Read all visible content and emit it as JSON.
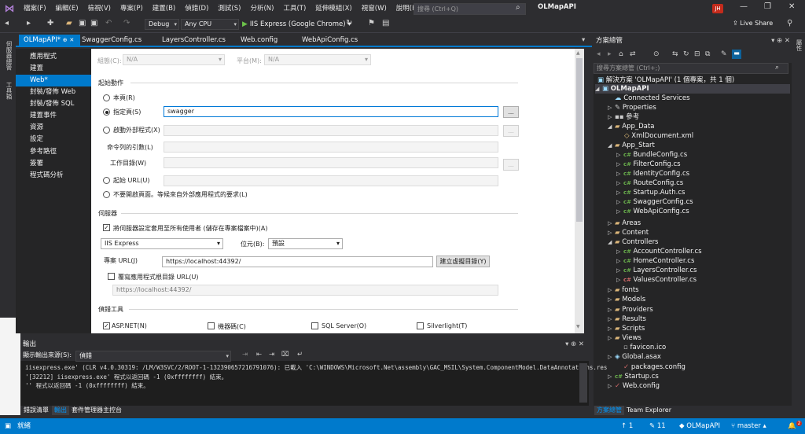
{
  "menu": [
    "檔案(F)",
    "編輯(E)",
    "檢視(V)",
    "專案(P)",
    "建置(B)",
    "偵錯(D)",
    "測試(S)",
    "分析(N)",
    "工具(T)",
    "延伸模組(X)",
    "視窗(W)",
    "說明(H)"
  ],
  "search": {
    "placeholder": "搜尋 (Ctrl+Q)"
  },
  "app_title": "OLMapAPI",
  "avatar": "JH",
  "toolbar": {
    "config": "Debug",
    "platform": "Any CPU",
    "run": "IIS Express (Google Chrome)",
    "live_share": "Live Share"
  },
  "left_strip": [
    "伺服器總管",
    "工具箱"
  ],
  "tabs": [
    "OLMapAPI*",
    "SwaggerConfig.cs",
    "LayersController.cs",
    "Web.config",
    "WebApiConfig.cs"
  ],
  "prop_pages": [
    "應用程式",
    "建置",
    "Web*",
    "封裝/發佈 Web",
    "封裝/發佈 SQL",
    "建置事件",
    "資源",
    "設定",
    "參考路徑",
    "簽署",
    "程式碼分析"
  ],
  "selected_prop_page": "Web*",
  "web": {
    "config_label": "組態(C):",
    "config_value": "N/A",
    "platform_label": "平台(M):",
    "platform_value": "N/A",
    "start_action": "起始動作",
    "current_page": "本頁(R)",
    "specific_page": "指定頁(S)",
    "specific_page_value": "swagger",
    "browse": "...",
    "start_external": "啟動外部程式(X)",
    "cmd_args": "命令列的引數(L)",
    "work_dir": "工作目錄(W)",
    "start_url": "起始 URL(U)",
    "dont_open": "不要開啟頁面。等候來自外部應用程式的要求(L)",
    "servers": "伺服器",
    "apply_all": "將伺服器設定套用至所有使用者 (儲存在專案檔案中)(A)",
    "server_value": "IIS Express",
    "bitness_label": "位元(B):",
    "bitness_value": "預設",
    "project_url_label": "專案 URL(J)",
    "project_url": "https://localhost:44392/",
    "create_vdir": "建立虛擬目錄(Y)",
    "override_root": "覆寫應用程式根目錄 URL(U)",
    "override_value": "https://localhost:44392/",
    "debuggers": "偵錯工具",
    "dbg": [
      "ASP.NET(N)",
      "機器碼(C)",
      "SQL Server(O)",
      "Silverlight(T)"
    ]
  },
  "solution_explorer": {
    "title": "方案總管",
    "search_placeholder": "搜尋方案總管 (Ctrl+;)",
    "solution": "解決方案 'OLMapAPI' (1 個專案，共 1 個)",
    "nodes": [
      {
        "label": "OLMapAPI",
        "icon": "project-icon"
      },
      {
        "label": "Connected Services",
        "icon": "connected-services-icon"
      },
      {
        "label": "Properties",
        "icon": "wrench-icon"
      },
      {
        "label": "參考",
        "icon": "references-icon"
      },
      {
        "label": "App_Data",
        "icon": "folder-icon"
      },
      {
        "label": "XmlDocument.xml",
        "icon": "xml-file-icon"
      },
      {
        "label": "App_Start",
        "icon": "folder-icon"
      },
      {
        "label": "BundleConfig.cs",
        "icon": "csharp-file-icon"
      },
      {
        "label": "FilterConfig.cs",
        "icon": "csharp-file-icon"
      },
      {
        "label": "IdentityConfig.cs",
        "icon": "csharp-file-icon"
      },
      {
        "label": "RouteConfig.cs",
        "icon": "csharp-file-icon"
      },
      {
        "label": "Startup.Auth.cs",
        "icon": "csharp-file-icon"
      },
      {
        "label": "SwaggerConfig.cs",
        "icon": "csharp-file-icon"
      },
      {
        "label": "WebApiConfig.cs",
        "icon": "csharp-file-icon"
      },
      {
        "label": "Areas",
        "icon": "folder-icon"
      },
      {
        "label": "Content",
        "icon": "folder-icon"
      },
      {
        "label": "Controllers",
        "icon": "folder-icon"
      },
      {
        "label": "AccountController.cs",
        "icon": "csharp-file-icon"
      },
      {
        "label": "HomeController.cs",
        "icon": "csharp-file-icon"
      },
      {
        "label": "LayersController.cs",
        "icon": "csharp-file-icon"
      },
      {
        "label": "ValuesController.cs",
        "icon": "csharp-file-icon"
      },
      {
        "label": "fonts",
        "icon": "folder-icon"
      },
      {
        "label": "Models",
        "icon": "folder-icon"
      },
      {
        "label": "Providers",
        "icon": "folder-icon"
      },
      {
        "label": "Results",
        "icon": "folder-icon"
      },
      {
        "label": "Scripts",
        "icon": "folder-icon"
      },
      {
        "label": "Views",
        "icon": "folder-icon"
      },
      {
        "label": "favicon.ico",
        "icon": "ico-file-icon"
      },
      {
        "label": "Global.asax",
        "icon": "asax-file-icon"
      },
      {
        "label": "packages.config",
        "icon": "config-file-icon"
      },
      {
        "label": "Startup.cs",
        "icon": "csharp-file-icon"
      },
      {
        "label": "Web.config",
        "icon": "config-file-icon"
      }
    ],
    "tabs": [
      "方案總管",
      "Team Explorer"
    ]
  },
  "output": {
    "title": "輸出",
    "source_label": "顯示輸出來源(S):",
    "source_value": "偵錯",
    "lines": [
      "iisexpress.exe' (CLR v4.0.30319: /LM/W3SVC/2/ROOT-1-132390657216791076): 已載入 'C:\\WINDOWS\\Microsoft.Net\\assembly\\GAC_MSIL\\System.ComponentModel.DataAnnotations.res",
      "'[32212] iisexpress.exe' 程式以返回碼 -1 (0xffffffff) 結束。",
      "'' 程式以返回碼 -1 (0xffffffff) 結束。"
    ],
    "tabs": [
      "錯誤清單",
      "輸出",
      "套件管理器主控台"
    ]
  },
  "status": {
    "ready": "就緒",
    "up": "1",
    "changes": "11",
    "repo": "OLMapAPI",
    "branch": "master",
    "notifications": "2"
  }
}
